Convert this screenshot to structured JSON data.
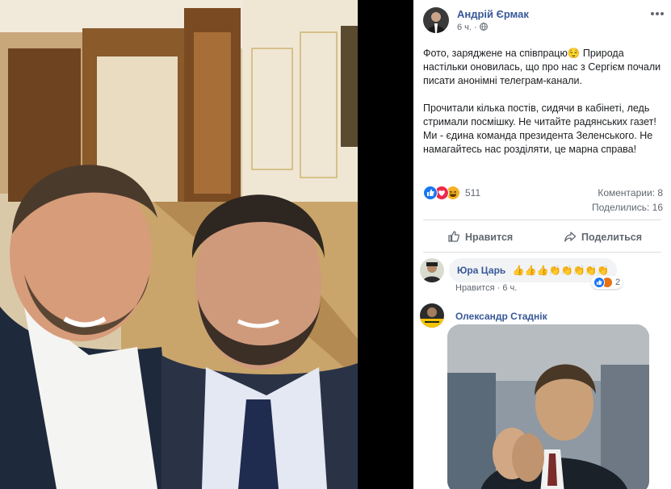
{
  "post": {
    "author": "Андрій Єрмак",
    "time": "6 ч.",
    "text": "Фото, заряджене на співпрацю😌 Природа настільки оновилась, що про нас з Сергієм почали писати анонімні телеграм-канали.\n\nПрочитали кілька постів, сидячи в кабінеті, ледь стримали посмішку. Не читайте радянських газет! Ми - єдина команда президента Зеленського. Не намагайтесь нас розділяти, це марна справа!",
    "reactions_count": "511",
    "comments_count": "Коментарии: 8",
    "shares_count": "Поделились: 16",
    "like_label": "Нравится",
    "share_label": "Поделиться"
  },
  "comments": [
    {
      "name": "Юра Царь",
      "text": "👍👍👍👏👏👏👏👏",
      "like_label": "Нравится",
      "time": "6 ч.",
      "reactions_count": "2"
    },
    {
      "name": "Олександр Стаднік"
    }
  ],
  "colors": {
    "link": "#385898",
    "like_blue": "#1877f2",
    "love_red": "#f0284a",
    "haha_yellow": "#f7b125"
  },
  "icons": [
    "globe-icon",
    "more-icon",
    "like-icon",
    "share-icon",
    "like-reaction-icon",
    "love-reaction-icon",
    "haha-reaction-icon"
  ]
}
